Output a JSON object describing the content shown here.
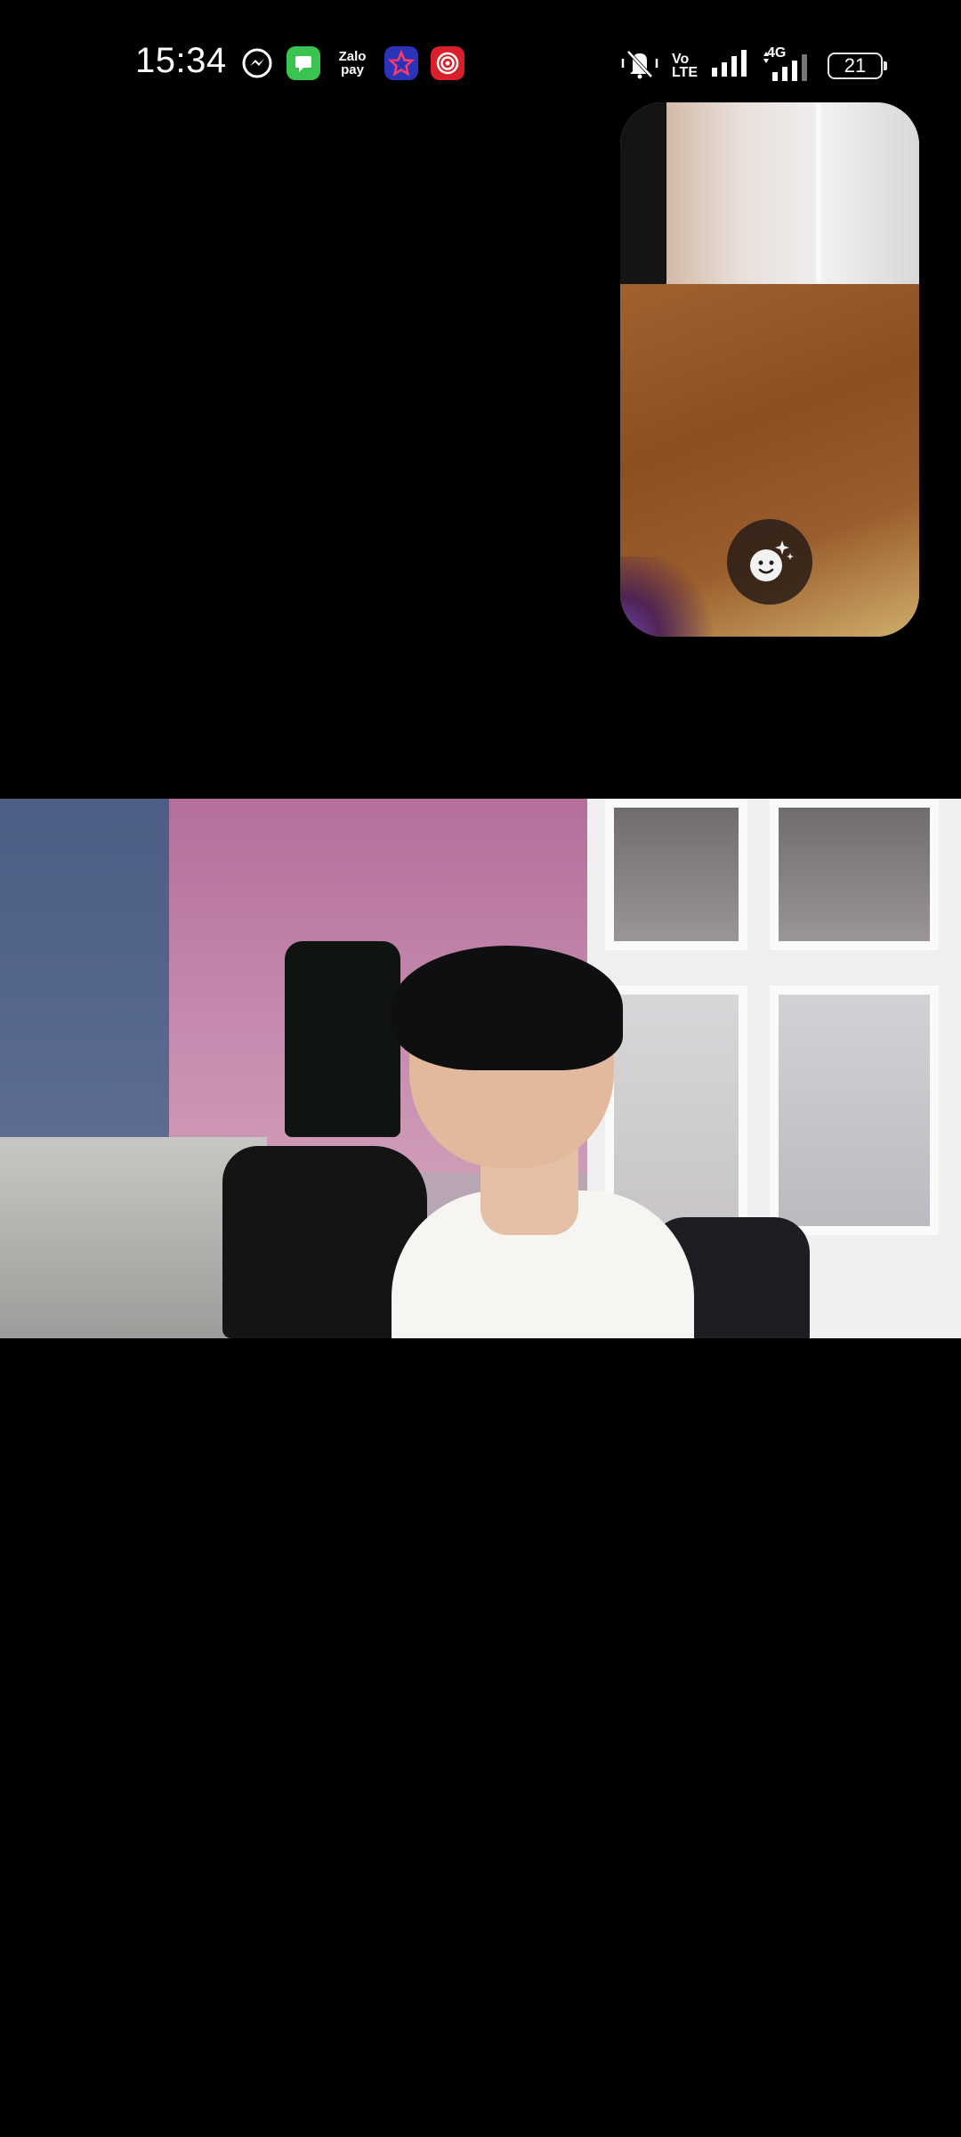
{
  "status_bar": {
    "time": "15:34",
    "notification_icons": [
      "messenger-icon",
      "messages-icon",
      "zalopay-icon",
      "star-app-icon",
      "target-app-icon"
    ],
    "zalopay_label_top": "Zalo",
    "zalopay_label_bottom": "pay",
    "volte_top": "Vo",
    "volte_bottom": "LTE",
    "network_type": "4G",
    "battery_level": "21",
    "colors": {
      "messages": "#38c44f",
      "star_app": "#2b33b8",
      "target_app": "#d8202a"
    }
  },
  "self_view": {
    "beauty_button_icon": "beauty-face-icon"
  },
  "remote_video": {
    "label": ""
  }
}
